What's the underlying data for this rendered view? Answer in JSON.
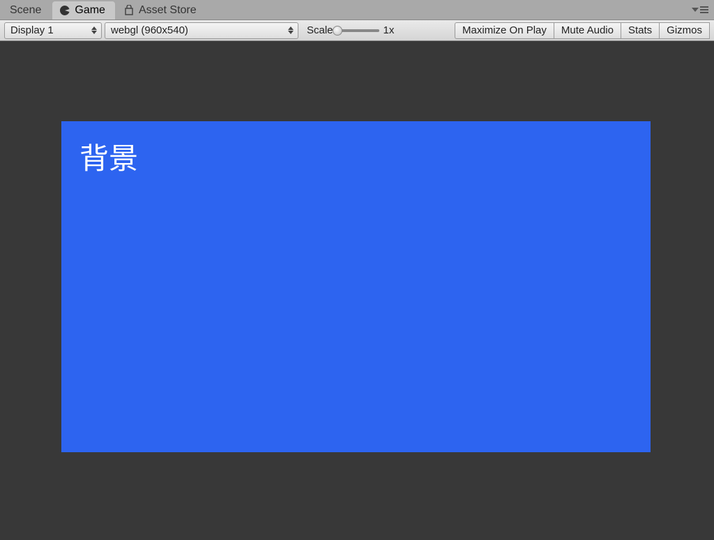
{
  "tabs": {
    "scene": {
      "label": "Scene"
    },
    "game": {
      "label": "Game"
    },
    "assetStore": {
      "label": "Asset Store"
    }
  },
  "toolbar": {
    "display": "Display 1",
    "aspect": "webgl (960x540)",
    "scaleLabel": "Scale",
    "scaleValue": "1x",
    "maximize": "Maximize On Play",
    "muteAudio": "Mute Audio",
    "stats": "Stats",
    "gizmos": "Gizmos"
  },
  "game": {
    "backgroundText": "背景",
    "colors": {
      "viewportBg": "#2d64f0",
      "areaBg": "#383838"
    }
  }
}
